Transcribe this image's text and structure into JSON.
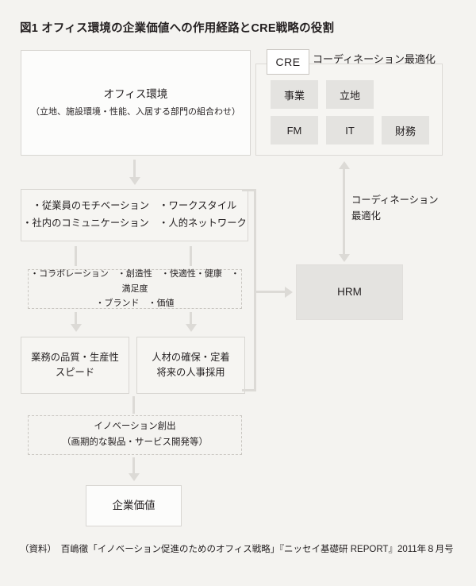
{
  "figure": {
    "title": "図1 オフィス環境の企業価値への作用経路とCRE戦略の役割",
    "source": "（資料）　百嶋徹「イノベーション促進のためのオフィス戦略」『ニッセイ基礎研 REPORT』2011年８月号"
  },
  "office": {
    "heading": "オフィス環境",
    "detail": "（立地、施設環境・性能、入居する部門の組合わせ）"
  },
  "cre": {
    "tab_label": "CRE",
    "heading": "コーディネーション最適化",
    "cells": [
      "事業",
      "立地",
      "FM",
      "IT",
      "財務"
    ]
  },
  "employee": {
    "line1_items": [
      "従業員のモチベーション",
      "ワークスタイル"
    ],
    "line2_items": [
      "社内のコミュニケーション",
      "人的ネットワーク"
    ],
    "line1": "・従業員のモチベーション　・ワークスタイル",
    "line2": "・社内のコミュニケーション　・人的ネットワーク"
  },
  "collaboration": {
    "line1": "・コラボレーション　・創造性　・快適性・健康　・満足度",
    "line2": "・ブランド　・価値",
    "items": [
      "コラボレーション",
      "創造性",
      "快適性・健康",
      "満足度",
      "ブランド",
      "価値"
    ]
  },
  "outcomes": [
    {
      "line1": "業務の品質・生産性",
      "line2": "スピード"
    },
    {
      "line1": "人材の確保・定着",
      "line2": "将来の人事採用"
    }
  ],
  "innovation": {
    "line1": "イノベーション創出",
    "line2": "（画期的な製品・サービス開発等）"
  },
  "corporate_value": {
    "label": "企業価値"
  },
  "hrm": {
    "label": "HRM"
  },
  "coordination": {
    "line1": "コーディネーション",
    "line2": "最適化"
  },
  "colors": {
    "page_background": "#f4f3f0",
    "box_gray": "#e4e3e0",
    "box_white": "#fcfcfb",
    "connector": "#dcdad6",
    "border": "#d8d6d2",
    "text": "#231f20"
  }
}
